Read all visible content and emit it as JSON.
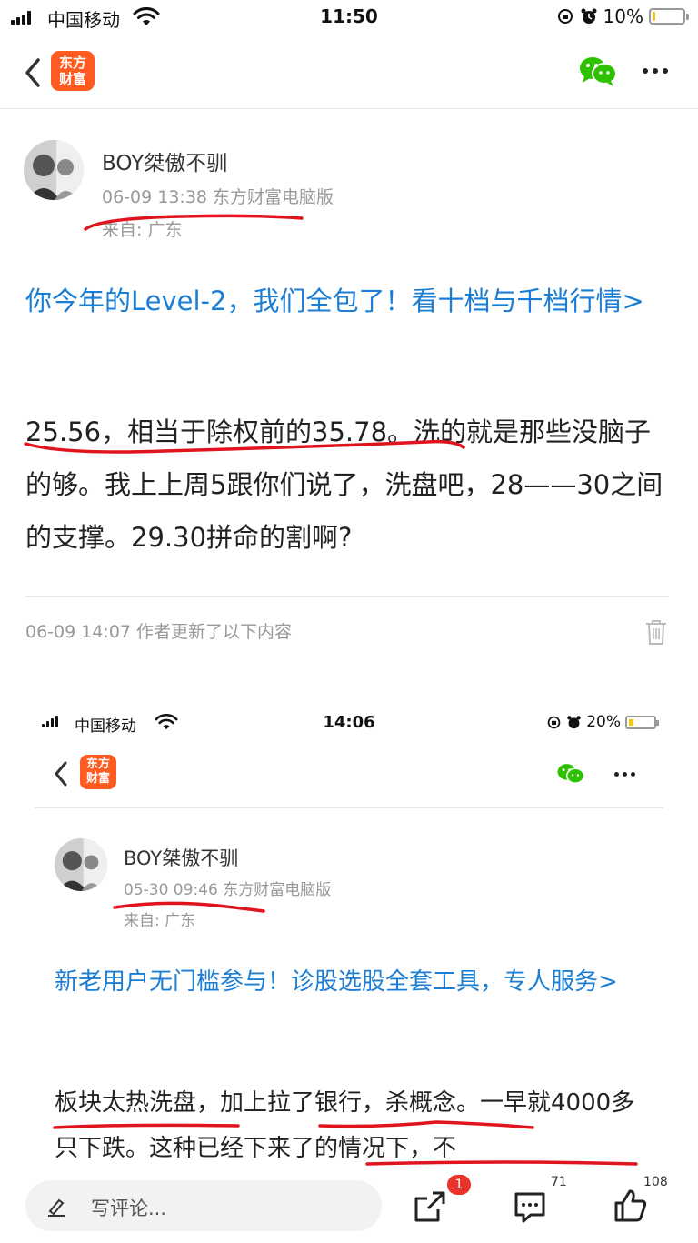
{
  "status_bar": {
    "carrier": "中国移动",
    "time": "11:50",
    "battery": "10%",
    "battery_level": 0.1
  },
  "nav": {
    "logo_line1": "东方",
    "logo_line2": "财富"
  },
  "post": {
    "author": "BOY桀傲不驯",
    "meta": "06-09 13:38 东方财富电脑版",
    "from": "来自: 广东",
    "promo": "你今年的Level-2，我们全包了！看十档与千档行情>",
    "body": "25.56，相当于除权前的35.78。洗的就是那些没脑子的够。我上上周5跟你们说了，洗盘吧，28——30之间的支撑。29.30拼命的割啊?",
    "update_note": "06-09 14:07  作者更新了以下内容"
  },
  "embedded": {
    "status_bar": {
      "carrier": "中国移动",
      "time": "14:06",
      "battery": "20%",
      "battery_level": 0.2
    },
    "logo_line1": "东方",
    "logo_line2": "财富",
    "author": "BOY桀傲不驯",
    "meta": "05-30 09:46 东方财富电脑版",
    "from": "来自: 广东",
    "promo": "新老用户无门槛参与！诊股选股全套工具，专人服务>",
    "body": "板块太热洗盘，加上拉了银行，杀概念。一早就4000多只下跌。这种已经下来了的情况下，不"
  },
  "bottom_bar": {
    "comment_placeholder": "写评论...",
    "share_badge": "1",
    "comment_count": "71",
    "like_count": "108"
  },
  "colors": {
    "link": "#1b7ed4",
    "brand": "#ff5a1f",
    "annotation": "#e0141e",
    "wechat": "#2dc100"
  }
}
